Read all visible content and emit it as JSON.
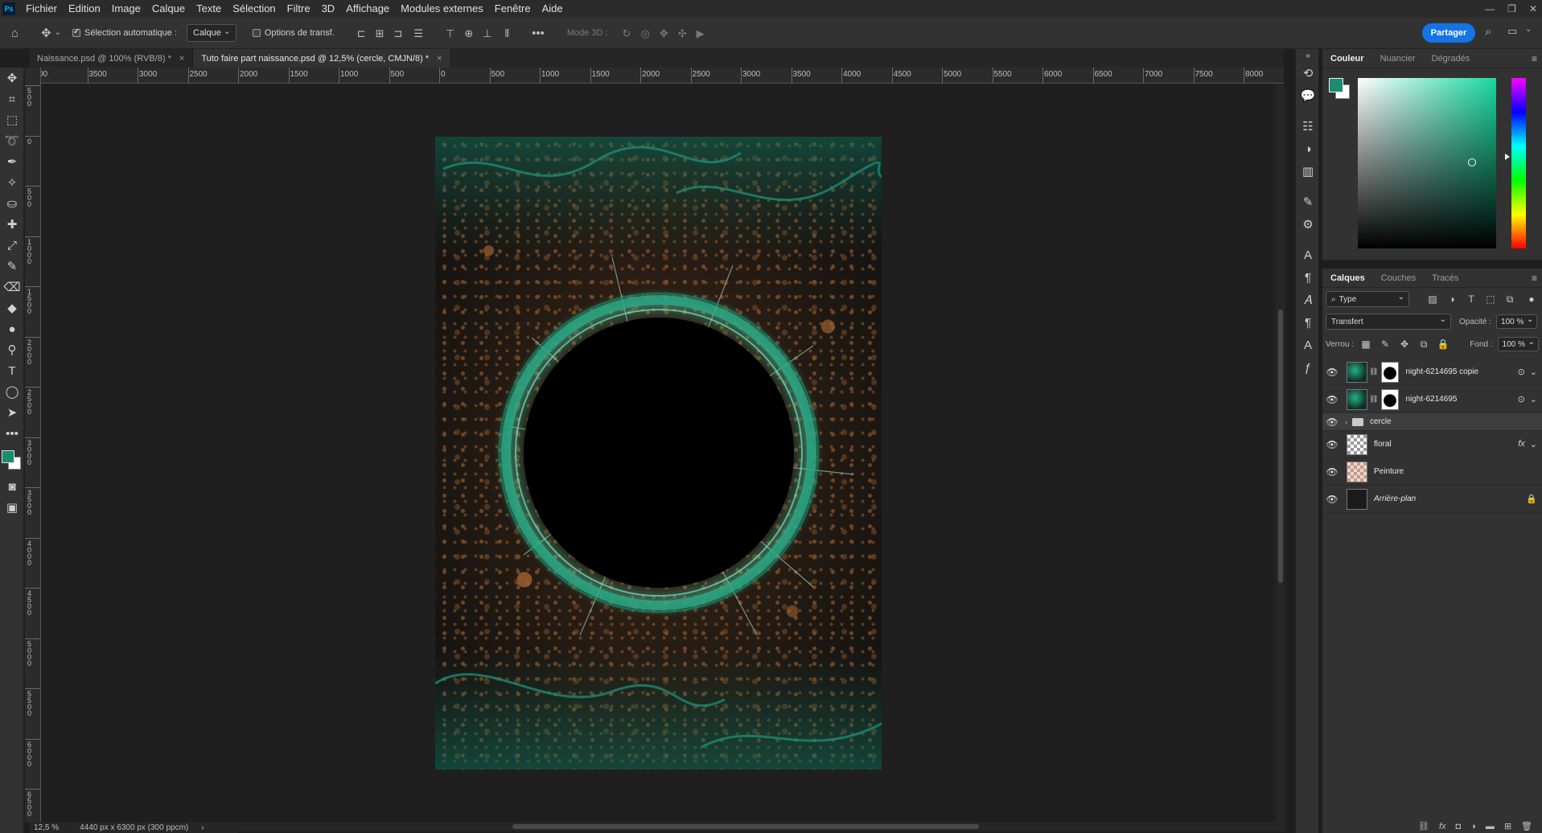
{
  "app": {
    "logo": "Ps"
  },
  "menu": [
    "Fichier",
    "Edition",
    "Image",
    "Calque",
    "Texte",
    "Sélection",
    "Filtre",
    "3D",
    "Affichage",
    "Modules externes",
    "Fenêtre",
    "Aide"
  ],
  "options": {
    "auto_select_label": "Sélection automatique :",
    "auto_select_value": "Calque",
    "transform_label": "Options de transf.",
    "mode3d_label": "Mode 3D :",
    "share_label": "Partager"
  },
  "tabs": [
    {
      "label": "Naissance.psd @ 100% (RVB/8) *",
      "active": false
    },
    {
      "label": "Tuto faire part naissance.psd @ 12,5% (cercle, CMJN/8) *",
      "active": true
    }
  ],
  "ruler_top_labels": [
    "00",
    "3500",
    "3000",
    "2500",
    "2000",
    "1500",
    "1000",
    "500",
    "0",
    "500",
    "1000",
    "1500",
    "2000",
    "2500",
    "3000",
    "3500",
    "4000",
    "4500",
    "5000",
    "5500",
    "6000",
    "6500",
    "7000",
    "7500",
    "8000"
  ],
  "ruler_left_labels": [
    "5 0 0",
    "0",
    "5 0 0",
    "1 0 0 0",
    "1 5 0 0",
    "2 0 0 0",
    "2 5 0 0",
    "3 0 0 0",
    "3 5 0 0",
    "4 0 0 0",
    "4 5 0 0",
    "5 0 0 0",
    "5 5 0 0",
    "6 0 0 0",
    "6 5 0 0"
  ],
  "status": {
    "zoom": "12,5 %",
    "doc_size": "4440 px x 6300 px (300 ppcm)"
  },
  "color_panel": {
    "tabs": [
      "Couleur",
      "Nuancier",
      "Dégradés"
    ],
    "foreground": "#1a8c70",
    "background": "#ffffff"
  },
  "layers_panel": {
    "tabs": [
      "Calques",
      "Couches",
      "Tracés"
    ],
    "filter_label": "Type",
    "blend_mode": "Transfert",
    "opacity_label": "Opacité :",
    "opacity_value": "100 %",
    "lock_label": "Verrou :",
    "fill_label": "Fond :",
    "fill_value": "100 %",
    "layers": [
      {
        "name": "night-6214695 copie"
      },
      {
        "name": "night-6214695"
      },
      {
        "name": "cercle"
      },
      {
        "name": "floral"
      },
      {
        "name": "Peinture"
      },
      {
        "name": "Arrière-plan"
      }
    ]
  },
  "icons": {
    "home": "home-icon",
    "move": "move-icon",
    "more": "more-icon",
    "search": "search-icon",
    "workspace": "workspace-icon"
  }
}
